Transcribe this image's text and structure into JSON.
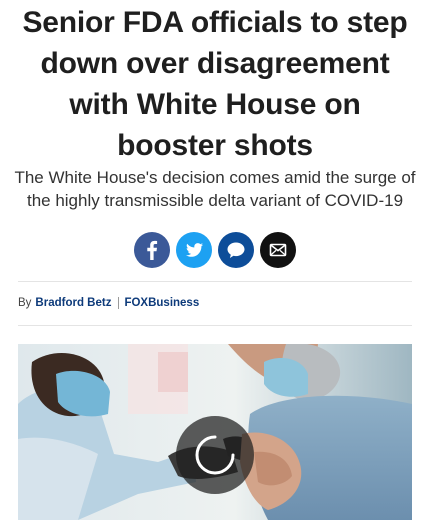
{
  "article": {
    "headline": "Senior FDA officials to step down over disagreement with White House on booster shots",
    "subheadline": "The White House's decision comes amid the surge of the highly transmissible delta variant of COVID-19"
  },
  "share": {
    "buttons": [
      {
        "name": "facebook",
        "icon": "facebook-icon",
        "color": "#3b5998"
      },
      {
        "name": "twitter",
        "icon": "twitter-icon",
        "color": "#1da1f2"
      },
      {
        "name": "comments",
        "icon": "comment-icon",
        "color": "#0d4d99"
      },
      {
        "name": "email",
        "icon": "envelope-icon",
        "color": "#111111"
      }
    ]
  },
  "byline": {
    "prefix": "By",
    "author": "Bradford Betz",
    "source": "FOXBusiness"
  },
  "media": {
    "icon": "loading-spinner-icon"
  }
}
